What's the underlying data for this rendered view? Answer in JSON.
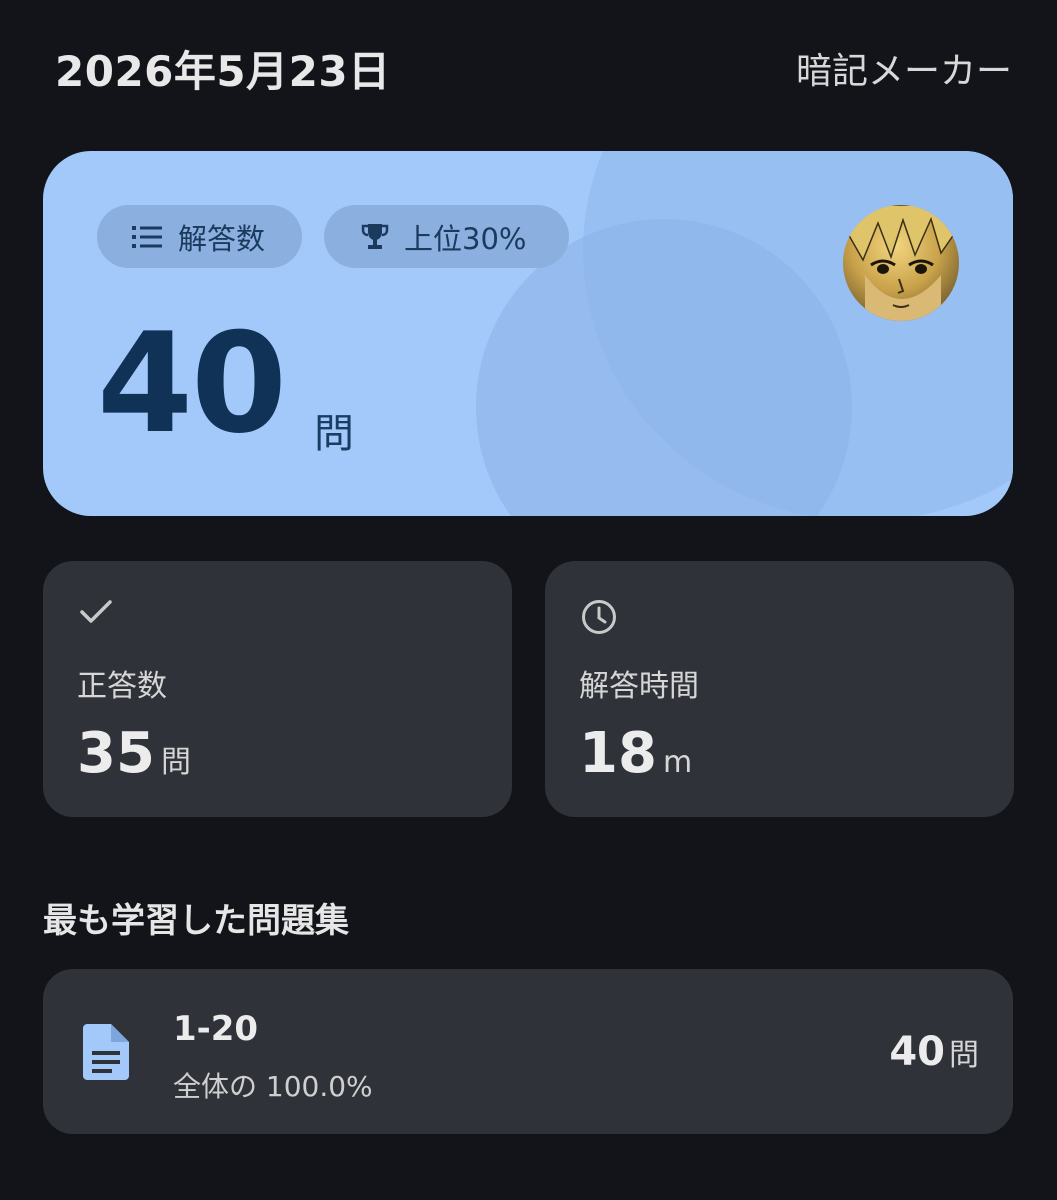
{
  "header": {
    "date": "2026年5月23日",
    "app_name": "暗記メーカー"
  },
  "hero": {
    "chip_answers_label": "解答数",
    "chip_answers_icon": "list-icon",
    "chip_rank_label": "上位30%",
    "chip_rank_icon": "trophy-icon",
    "answered_count": "40",
    "answered_unit": "問",
    "background_color": "#a3c9fa",
    "avatar": "user-avatar"
  },
  "stats": [
    {
      "icon": "check-icon",
      "label": "正答数",
      "value": "35",
      "unit": "問"
    },
    {
      "icon": "clock-icon",
      "label": "解答時間",
      "value": "18",
      "unit": "m"
    }
  ],
  "most_studied": {
    "title": "最も学習した問題集",
    "item": {
      "icon": "document-icon",
      "name": "1-20",
      "share": "全体の 100.0%",
      "count": "40",
      "count_unit": "問"
    }
  }
}
